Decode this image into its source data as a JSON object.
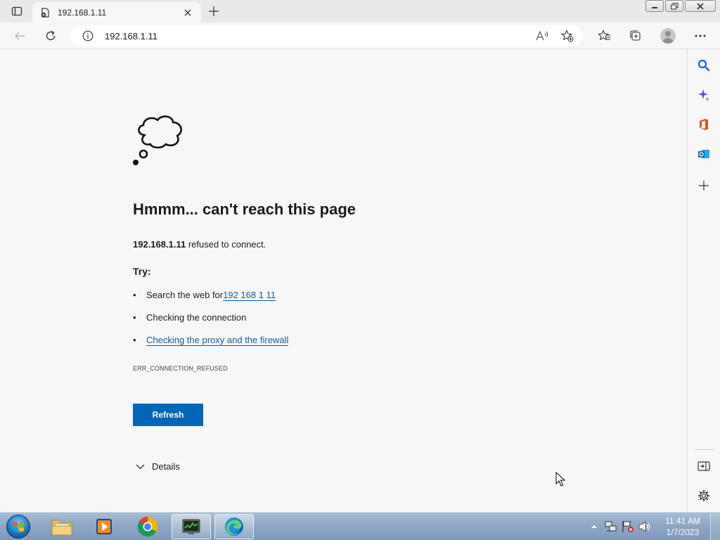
{
  "tab": {
    "title": "192.168.1.11"
  },
  "address": {
    "url": "192.168.1.11"
  },
  "error": {
    "heading": "Hmmm... can't reach this page",
    "host": "192.168.1.11",
    "message_suffix": " refused to connect.",
    "try_label": "Try:",
    "suggestions": [
      {
        "prefix": "Search the web for ",
        "link": "192 168 1 11"
      },
      {
        "text": "Checking the connection"
      },
      {
        "link": "Checking the proxy and the firewall"
      }
    ],
    "code": "ERR_CONNECTION_REFUSED",
    "refresh_label": "Refresh",
    "details_label": "Details"
  },
  "taskbar": {
    "time": "11:41 AM",
    "date": "1/7/2023"
  },
  "colors": {
    "accent": "#0067b8",
    "link": "#0f5c9c",
    "page_bg": "#f7f7f7",
    "titlebar_bg": "#e9e9e9"
  }
}
